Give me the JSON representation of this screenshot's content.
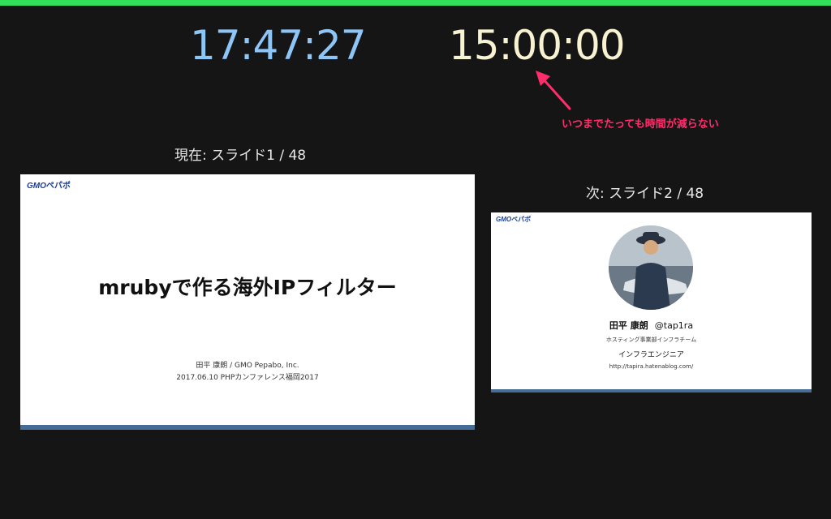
{
  "clocks": {
    "current_time": "17:47:27",
    "elapsed_time": "15:00:00",
    "current_color": "#8ec5f7",
    "elapsed_color": "#f7f2d2"
  },
  "annotation": {
    "text": "いつまでたっても時間が減らない",
    "color": "#ff2d6c"
  },
  "current": {
    "label": "現在: スライド1 / 48",
    "slide": {
      "logo_gmo": "GMO",
      "logo_pepabo": "ペパボ",
      "title": "mrubyで作る海外IPフィルター",
      "byline1": "田平 康朗 / GMO Pepabo, Inc.",
      "byline2": "2017.06.10 PHPカンファレンス福岡2017"
    }
  },
  "next": {
    "label": "次: スライド2 / 48",
    "slide": {
      "logo_gmo": "GMO",
      "logo_pepabo": "ペパボ",
      "name": "田平 康朗",
      "handle": "@tap1ra",
      "dept": "ホスティング事業部インフラチーム",
      "role": "インフラエンジニア",
      "url": "http://tapira.hatenablog.com/"
    }
  },
  "colors": {
    "top_bar": "#33e05a",
    "background": "#151515",
    "slide_band": "#466d97"
  }
}
